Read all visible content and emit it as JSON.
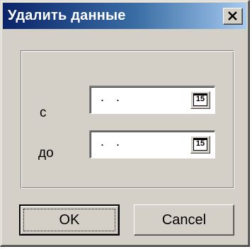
{
  "window": {
    "title": "Удалить данные"
  },
  "fields": [
    {
      "label": "с",
      "value": ". .",
      "calendar_icon_text": "15"
    },
    {
      "label": "до",
      "value": ". .",
      "calendar_icon_text": "15"
    }
  ],
  "buttons": {
    "ok_label": "OK",
    "cancel_label": "Cancel"
  },
  "colors": {
    "title_gradient_start": "#0a246a",
    "title_gradient_end": "#a6caf0",
    "face": "#d4d0c8"
  },
  "icons": {
    "close": "close-icon",
    "calendar": "calendar-icon"
  }
}
